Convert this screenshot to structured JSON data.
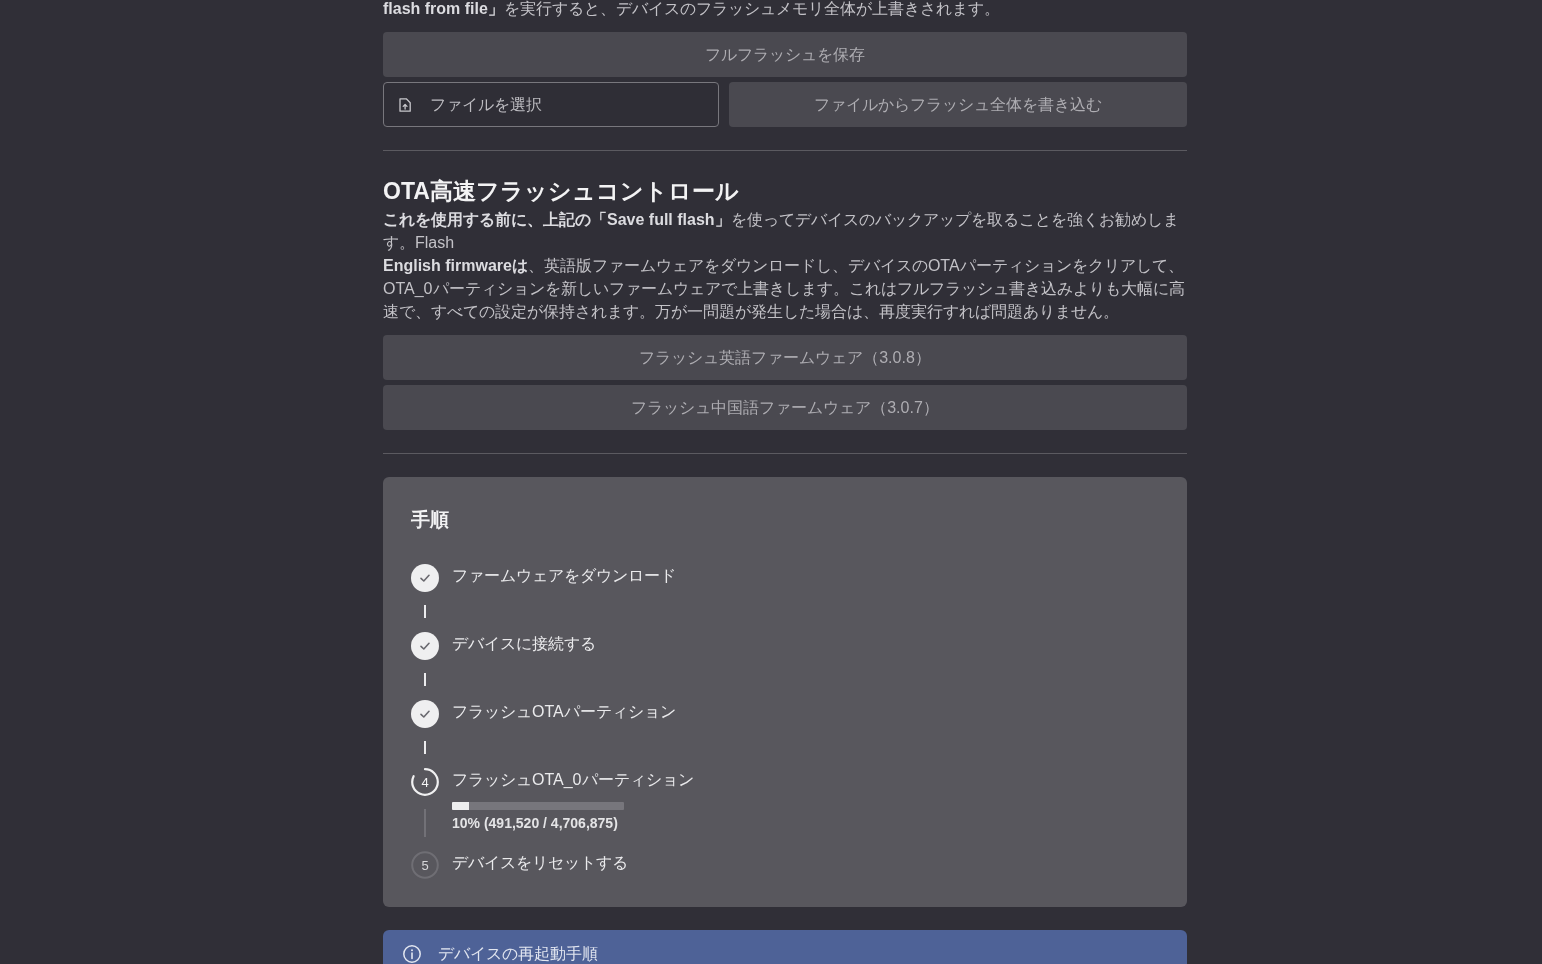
{
  "top_text": "**flash from file」**を実行すると、デバイスのフラッシュメモリ全体が上書きされます。",
  "backup": {
    "save_button": "フルフラッシュを保存",
    "file_picker": {
      "label": "ファイルを選択"
    },
    "write_button": "ファイルからフラッシュ全体を書き込む"
  },
  "ota": {
    "title": "OTA高速フラッシュコントロール",
    "paragraphs": [
      "**これを使用する前に、上記の「Save full flash」**を使ってデバイスのバックアップを取ることを強くお勧めします。Flash",
      "**English firmwareは**、英語版ファームウェアをダウンロードし、デバイスのOTAパーティションをクリアして、OTA_0パーティションを新しいファームウェアで上書きします。これはフルフラッシュ書き込みよりも大幅に高速で、すべての設定が保持されます。万が一問題が発生した場合は、再度実行すれば問題ありません。"
    ],
    "buttons": [
      "フラッシュ英語ファームウェア（3.0.8）",
      "フラッシュ中国語ファームウェア（3.0.7）"
    ]
  },
  "steps_card": {
    "title": "手順",
    "steps": [
      {
        "label": "ファームウェアをダウンロード",
        "completed": true,
        "current": false
      },
      {
        "label": "デバイスに接続する",
        "completed": true,
        "current": false
      },
      {
        "label": "フラッシュOTAパーティション",
        "completed": true,
        "current": false
      },
      {
        "label": "フラッシュOTA_0パーティション",
        "completed": false,
        "current": true,
        "number": "4",
        "progress": {
          "level": 0.1,
          "reading": "10% (491,520 / 4,706,875)"
        }
      },
      {
        "label": "デバイスをリセットする",
        "completed": false,
        "current": false,
        "number": "5"
      }
    ]
  },
  "notice": {
    "title": "デバイスの再起動手順"
  }
}
